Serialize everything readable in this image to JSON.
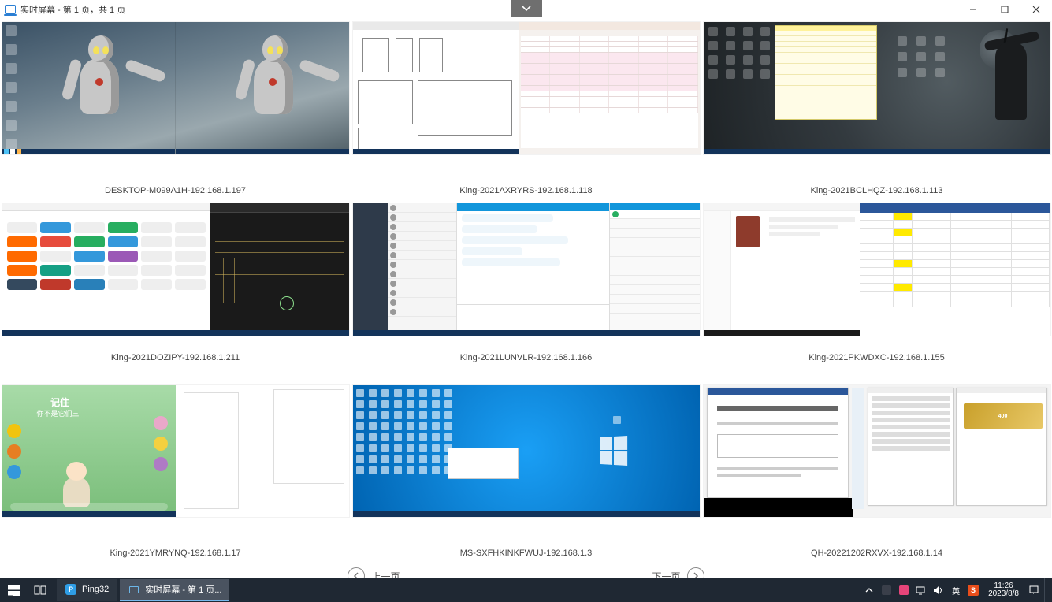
{
  "window": {
    "title": "实时屏幕 - 第 1 页，共 1 页",
    "dropdown_glyph": "▾"
  },
  "grid": {
    "items": [
      {
        "label": "DESKTOP-M099A1H-192.168.1.197"
      },
      {
        "label": "King-2021AXRYRS-192.168.1.118"
      },
      {
        "label": "King-2021BCLHQZ-192.168.1.113"
      },
      {
        "label": "King-2021DOZIPY-192.168.1.211"
      },
      {
        "label": "King-2021LUNVLR-192.168.1.166"
      },
      {
        "label": "King-2021PKWDXC-192.168.1.155"
      },
      {
        "label": "King-2021YMRYNQ-192.168.1.17"
      },
      {
        "label": "MS-SXFHKINKFWUJ-192.168.1.3"
      },
      {
        "label": "QH-20221202RXVX-192.168.1.14"
      }
    ]
  },
  "thumb7": {
    "title": "记住",
    "subtitle": "你不是它们三"
  },
  "pager": {
    "prev": "上一页",
    "next": "下一页"
  },
  "taskbar": {
    "app1_label": "Ping32",
    "app2_label": "实时屏幕 - 第 1 页..."
  },
  "tray": {
    "ime_lang": "英",
    "time": "11:26",
    "date": "2023/8/8"
  }
}
